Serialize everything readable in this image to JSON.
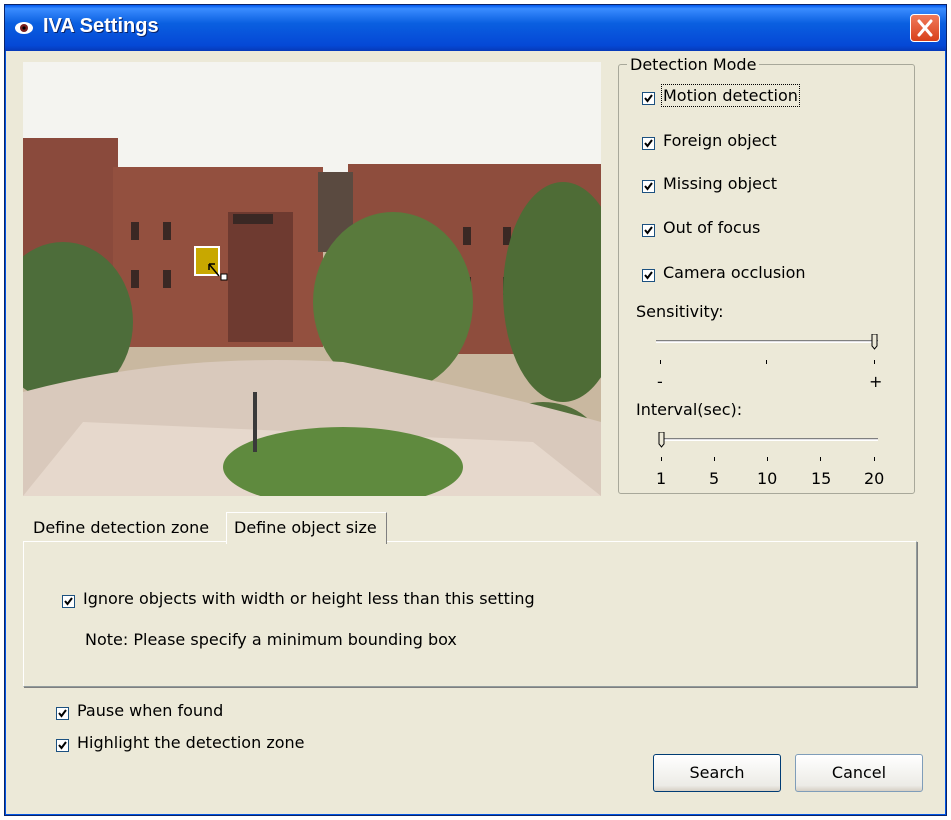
{
  "window": {
    "title": "IVA Settings"
  },
  "detection_mode": {
    "legend": "Detection Mode",
    "options": [
      {
        "label": "Motion detection",
        "checked": true
      },
      {
        "label": "Foreign object",
        "checked": true
      },
      {
        "label": "Missing object",
        "checked": true
      },
      {
        "label": "Out of focus",
        "checked": true
      },
      {
        "label": "Camera occlusion",
        "checked": true
      }
    ],
    "sensitivity": {
      "label": "Sensitivity:",
      "min_label": "-",
      "max_label": "+",
      "value": 1.0
    },
    "interval": {
      "label": "Interval(sec):",
      "ticks": [
        "1",
        "5",
        "10",
        "15",
        "20"
      ],
      "value": 1
    }
  },
  "tabs": [
    {
      "label": "Define detection zone",
      "active": false
    },
    {
      "label": "Define object size",
      "active": true
    }
  ],
  "object_size": {
    "ignore_label": "Ignore objects with width or height less than this setting",
    "ignore_checked": true,
    "note": "Note: Please specify a minimum bounding box"
  },
  "options": {
    "pause_label": "Pause when found",
    "pause_checked": true,
    "highlight_label": "Highlight the detection zone",
    "highlight_checked": true
  },
  "buttons": {
    "search": "Search",
    "cancel": "Cancel"
  },
  "colors": {
    "titlebar": "#0548d6",
    "dialog_bg": "#ece9d8",
    "box_marker": "#c8a800"
  }
}
